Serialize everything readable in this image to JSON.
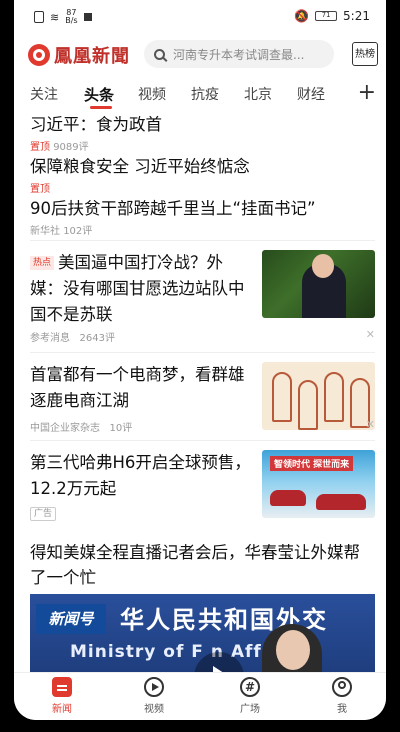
{
  "status_bar": {
    "speed_top": "87",
    "speed_unit": "B/s",
    "battery": "71",
    "time": "5:21"
  },
  "header": {
    "logo_text": "鳳凰新聞",
    "search_placeholder": "河南专升本考试调查最...",
    "hot_label": "热榜"
  },
  "tabs": [
    {
      "label": "关注"
    },
    {
      "label": "头条"
    },
    {
      "label": "视频"
    },
    {
      "label": "抗疫"
    },
    {
      "label": "北京"
    },
    {
      "label": "财经"
    }
  ],
  "feed": {
    "top_items": [
      {
        "title": "习近平：食为政首",
        "pin": "置顶",
        "comments": "9089评"
      },
      {
        "title": "保障粮食安全 习近平始终惦念",
        "pin": "置顶"
      },
      {
        "title": "90后扶贫干部跨越千里当上“挂面书记”",
        "source": "新华社",
        "comments": "102评"
      }
    ],
    "cards": [
      {
        "tag": "热点",
        "title": "美国逼中国打冷战？外媒：没有哪国甘愿选边站队中国不是苏联",
        "source": "参考消息",
        "comments": "2643评"
      },
      {
        "title": "首富都有一个电商梦，看群雄逐鹿电商江湖",
        "source": "中国企业家杂志",
        "comments": "10评"
      },
      {
        "title": "第三代哈弗H6开启全球预售，12.2万元起",
        "ad": "广告",
        "thumb_banner": "智领时代 探世而来"
      }
    ],
    "video_item": {
      "title": "得知美媒全程直播记者会后，华春莹让外媒帮了一个忙",
      "badge": "新闻号",
      "caption": "华人民共和国外交",
      "caption2": "Ministry of F  n Affa"
    }
  },
  "bottom_nav": [
    {
      "label": "新闻"
    },
    {
      "label": "视频"
    },
    {
      "label": "广场"
    },
    {
      "label": "我"
    }
  ],
  "colors": {
    "accent": "#e03a2f"
  }
}
